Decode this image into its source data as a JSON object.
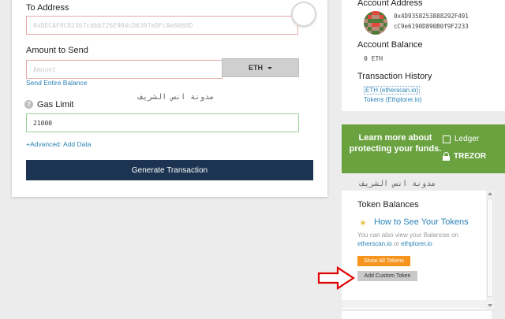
{
  "form": {
    "to_address_label": "To Address",
    "to_address_placeholder": "0xDECAF9CD2367cdbb726E904cD6397eDFcAe6068D",
    "amount_label": "Amount to Send",
    "amount_placeholder": "Amount",
    "unit": "ETH",
    "send_entire_balance": "Send Entire Balance",
    "gas_limit_label": "Gas Limit",
    "gas_limit_value": "21000",
    "advanced_link": "+Advanced: Add Data",
    "generate_button": "Generate Transaction",
    "help_glyph": "?"
  },
  "watermarks": {
    "text": "مدونة انس الشريف"
  },
  "account": {
    "address_title": "Account Address",
    "address_line1": "0x4D9358253888292F491",
    "address_line2": "cC9e6190D890B0f9F2233",
    "balance_title": "Account Balance",
    "balance_value": "0 ETH",
    "history_title": "Transaction History",
    "history_eth": "ETH (etherscan.io)",
    "history_tokens": "Tokens (Ethplorer.io)"
  },
  "promo": {
    "text": "Learn more about protecting your funds.",
    "brand1": "Ledger",
    "brand2": "TREZOR",
    "background": "#6aa240"
  },
  "tokens": {
    "title": "Token Balances",
    "howto": "How to See Your Tokens",
    "note_prefix": "You can also view your Balances on",
    "note_link1": "etherscan.io",
    "note_middle": " or ",
    "note_link2": "ethplorer.io",
    "show_all": "Show All Tokens",
    "add_custom": "Add Custom Token"
  },
  "colors": {
    "accent": "#2a83b6",
    "primary_button": "#1d3352",
    "orange_button": "#f7941d",
    "arrow": "#e00000"
  }
}
